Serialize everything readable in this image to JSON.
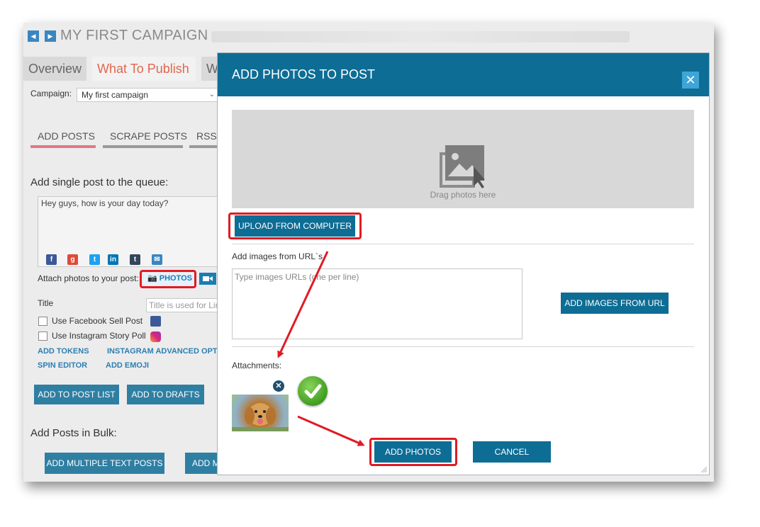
{
  "app": {
    "title": "MY FIRST CAMPAIGN",
    "tabs": [
      {
        "label": "Overview"
      },
      {
        "label": "What To Publish"
      },
      {
        "label": "W"
      }
    ],
    "campaign_label": "Campaign:",
    "campaign_value": "My first campaign",
    "subtabs": [
      {
        "label": "ADD POSTS"
      },
      {
        "label": "SCRAPE POSTS"
      },
      {
        "label": "RSS"
      }
    ],
    "single_post_title": "Add single post to the queue:",
    "post_text": "Hey guys, how is your day today?",
    "attach_label": "Attach photos to your post:",
    "photos_button": "PHOTOS",
    "title_label": "Title",
    "title_placeholder": "Title is used for Lin",
    "checkbox_fb": "Use Facebook Sell Post",
    "checkbox_ig": "Use Instagram Story Poll",
    "links": {
      "add_tokens": "ADD TOKENS",
      "instagram_advanced": "INSTAGRAM ADVANCED OPTI",
      "spin_editor": "SPIN EDITOR",
      "add_emoji": "ADD EMOJI"
    },
    "add_to_post_list": "ADD TO POST LIST",
    "add_to_drafts": "ADD TO DRAFTS",
    "bulk_title": "Add Posts in Bulk:",
    "add_multiple_text_posts": "ADD MULTIPLE TEXT POSTS",
    "add_m_truncated": "ADD M"
  },
  "modal": {
    "title": "ADD PHOTOS TO POST",
    "close": "✕",
    "drop_text": "Drag photos here",
    "upload_button": "UPLOAD FROM COMPUTER",
    "url_label": "Add images from URL`s",
    "url_placeholder": "Type images URLs (one per line)",
    "add_from_url_button": "ADD IMAGES FROM URL",
    "attachments_label": "Attachments:",
    "add_photos_button": "ADD PHOTOS",
    "cancel_button": "CANCEL"
  },
  "colors": {
    "header_blue": "#0e6d95",
    "highlight_red": "#e01b24",
    "active_tab": "#e0674f"
  }
}
